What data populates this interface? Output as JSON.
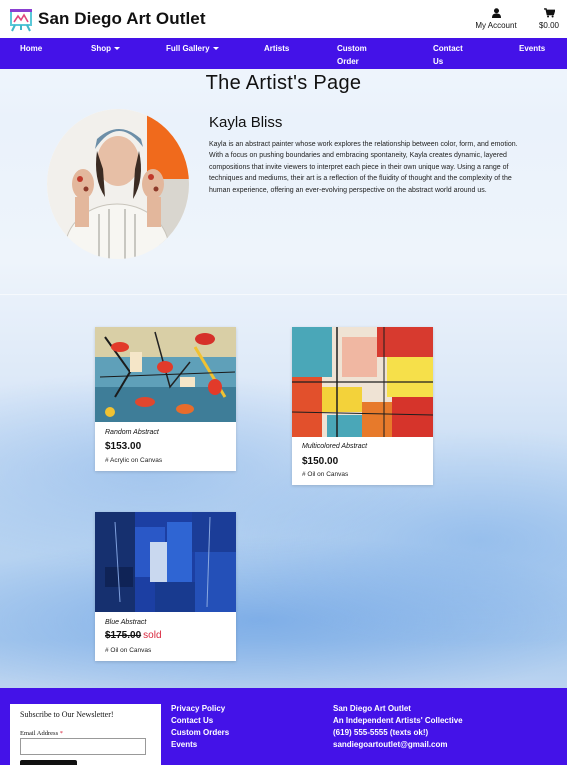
{
  "header": {
    "brand": "San Diego Art Outlet",
    "account_label": "My Account",
    "cart_total": "$0.00"
  },
  "nav": {
    "items": [
      {
        "label": "Home"
      },
      {
        "label": "Shop"
      },
      {
        "label": "Full Gallery"
      },
      {
        "label": "Artists"
      },
      {
        "label": "Custom Order"
      },
      {
        "label": "Contact Us"
      },
      {
        "label": "Events"
      }
    ]
  },
  "artist": {
    "page_title": "The Artist's Page",
    "name": "Kayla Bliss",
    "bio": "Kayla is an abstract painter whose work explores the relationship between color, form, and emotion. With a focus on pushing boundaries and embracing spontaneity, Kayla creates dynamic, layered compositions that invite viewers to interpret each piece in their own unique way. Using a range of techniques and mediums, their art is a reflection of the fluidity of thought and the complexity of the human experience, offering an ever-evolving perspective on the abstract world around us."
  },
  "products": [
    {
      "title": "Random Abstract",
      "price": "$153.00",
      "sold_label": "",
      "tag": "# Acrylic on Canvas"
    },
    {
      "title": "Multicolored Abstract",
      "price": "$150.00",
      "sold_label": "",
      "tag": "# Oil on Canvas"
    },
    {
      "title": "Blue Abstract",
      "price": "$175.00",
      "sold_label": "sold",
      "tag": "# Oil on Canvas"
    }
  ],
  "footer": {
    "newsletter": {
      "title": "Subscribe to Our Newsletter!",
      "email_label": "Email Address",
      "required_mark": "*",
      "email_value": ""
    },
    "links": [
      "Privacy Policy",
      "Contact Us",
      "Custom Orders",
      "Events"
    ],
    "info": [
      "San Diego Art Outlet",
      "An Independent Artists' Collective",
      "(619) 555-5555 (texts ok!)",
      "sandiegoartoutlet@gmail.com"
    ]
  },
  "colors": {
    "nav_bg": "#4412e8",
    "sold": "#d9263d"
  },
  "icons": [
    "easel-logo-icon",
    "user-icon",
    "cart-icon",
    "chevron-down-icon"
  ]
}
